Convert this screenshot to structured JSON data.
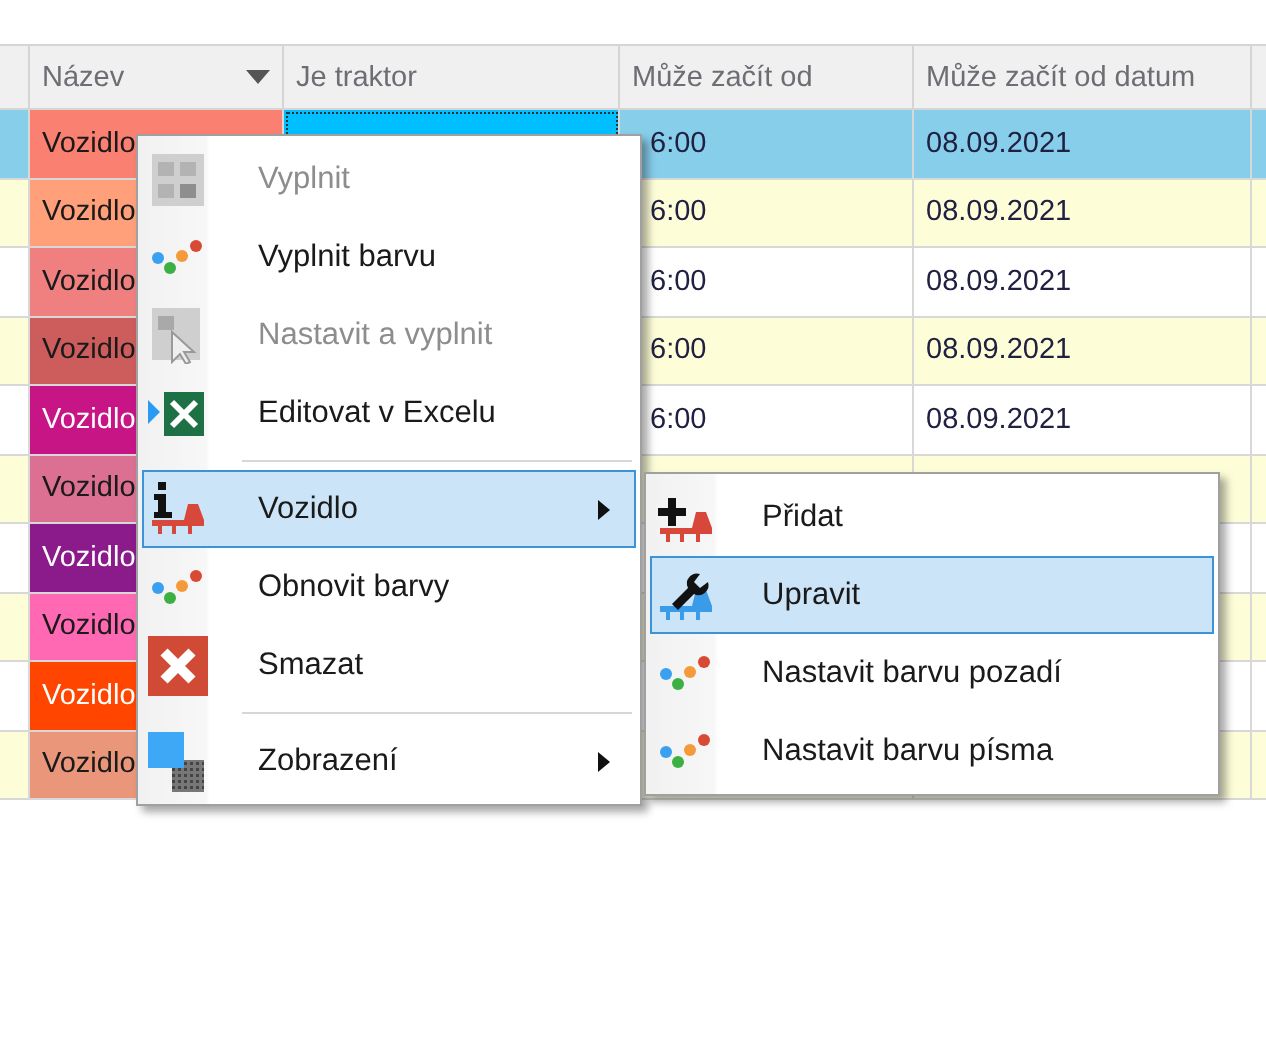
{
  "table": {
    "columns": [
      {
        "label": "Název",
        "dropdown": true
      },
      {
        "label": "Je traktor",
        "dropdown": false
      },
      {
        "label": "Může začít od",
        "dropdown": false
      },
      {
        "label": "Může začít od datum",
        "dropdown": false
      }
    ],
    "rows": [
      {
        "name": "Vozidlo",
        "color": "#fa8072",
        "selected": true,
        "time": "6:00",
        "date": "08.09.2021"
      },
      {
        "name": "Vozidlo",
        "color": "#ffa07a",
        "selected": false,
        "time": "6:00",
        "date": "08.09.2021"
      },
      {
        "name": "Vozidlo",
        "color": "#f08080",
        "selected": false,
        "time": "6:00",
        "date": "08.09.2021"
      },
      {
        "name": "Vozidlo",
        "color": "#cd5c5c",
        "selected": false,
        "time": "6:00",
        "date": "08.09.2021"
      },
      {
        "name": "Vozidlo",
        "color": "#c71585",
        "selected": false,
        "time": "6:00",
        "date": "08.09.2021"
      },
      {
        "name": "Vozidlo",
        "color": "#db7093",
        "selected": false
      },
      {
        "name": "Vozidlo",
        "color": "#8b1a8b",
        "selected": false
      },
      {
        "name": "Vozidlo",
        "color": "#ff69b4",
        "selected": false
      },
      {
        "name": "Vozidlo",
        "color": "#ff4500",
        "selected": false
      },
      {
        "name": "Vozidlo",
        "color": "#e9967a",
        "selected": false
      }
    ]
  },
  "context_menu": {
    "items": [
      {
        "kind": "item",
        "label": "Vyplnit",
        "disabled": true,
        "selected": false,
        "submenu": false
      },
      {
        "kind": "item",
        "label": "Vyplnit barvu",
        "disabled": false,
        "selected": false,
        "submenu": false
      },
      {
        "kind": "item",
        "label": "Nastavit a vyplnit",
        "disabled": true,
        "selected": false,
        "submenu": false
      },
      {
        "kind": "item",
        "label": "Editovat v Excelu",
        "disabled": false,
        "selected": false,
        "submenu": false
      },
      {
        "kind": "separator"
      },
      {
        "kind": "item",
        "label": "Vozidlo",
        "disabled": false,
        "selected": true,
        "submenu": true
      },
      {
        "kind": "item",
        "label": "Obnovit barvy",
        "disabled": false,
        "selected": false,
        "submenu": false
      },
      {
        "kind": "item",
        "label": "Smazat",
        "disabled": false,
        "selected": false,
        "submenu": false
      },
      {
        "kind": "separator"
      },
      {
        "kind": "item",
        "label": "Zobrazení",
        "disabled": false,
        "selected": false,
        "submenu": true
      }
    ]
  },
  "submenu": {
    "items": [
      {
        "label": "Přidat",
        "selected": false
      },
      {
        "label": "Upravit",
        "selected": true
      },
      {
        "label": "Nastavit barvu pozadí",
        "selected": false
      },
      {
        "label": "Nastavit barvu písma",
        "selected": false
      }
    ]
  }
}
